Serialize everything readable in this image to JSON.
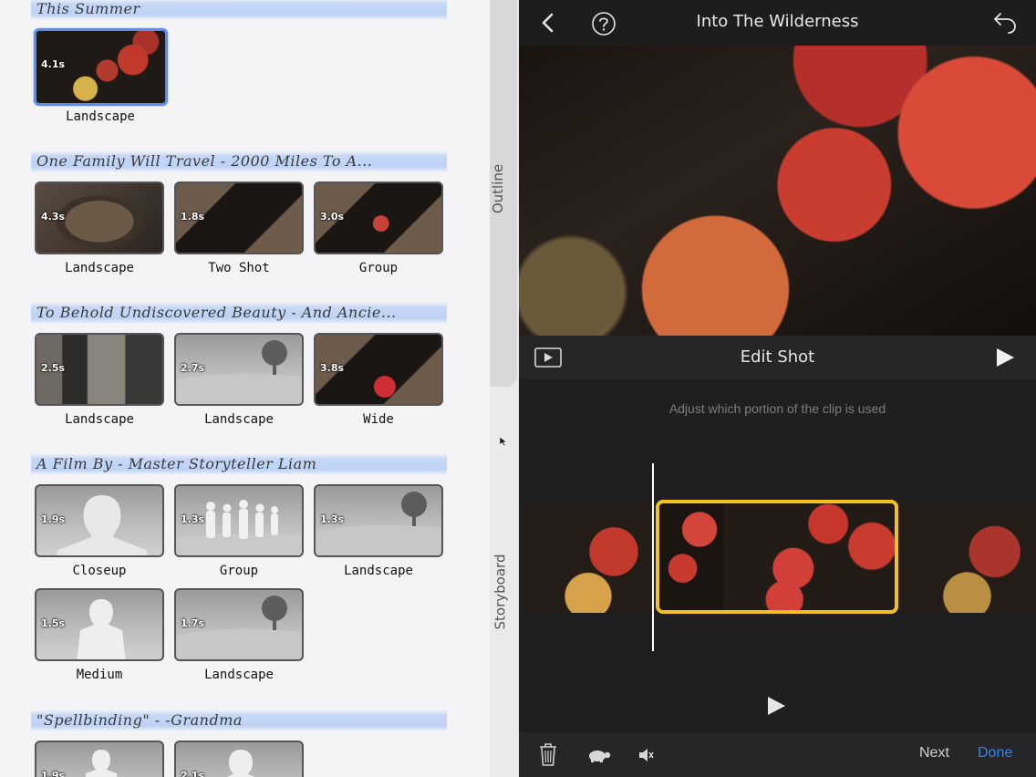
{
  "storyboard": {
    "sections": [
      {
        "title": "This Summer",
        "shots": [
          {
            "duration": "4.1s",
            "label": "Landscape",
            "type": "photo"
          }
        ]
      },
      {
        "title": "One Family Will Travel - 2000 Miles To A...",
        "shots": [
          {
            "duration": "4.3s",
            "label": "Landscape",
            "type": "photo"
          },
          {
            "duration": "1.8s",
            "label": "Two Shot",
            "type": "photo"
          },
          {
            "duration": "3.0s",
            "label": "Group",
            "type": "photo"
          }
        ]
      },
      {
        "title": "To Behold Undiscovered Beauty - And Ancie...",
        "shots": [
          {
            "duration": "2.5s",
            "label": "Landscape",
            "type": "photo"
          },
          {
            "duration": "2.7s",
            "label": "Landscape",
            "type": "placeholder-landscape"
          },
          {
            "duration": "3.8s",
            "label": "Wide",
            "type": "photo"
          }
        ]
      },
      {
        "title": "A Film By - Master Storyteller Liam",
        "shots": [
          {
            "duration": "1.9s",
            "label": "Closeup",
            "type": "placeholder-closeup"
          },
          {
            "duration": "1.3s",
            "label": "Group",
            "type": "placeholder-group"
          },
          {
            "duration": "1.3s",
            "label": "Landscape",
            "type": "placeholder-landscape"
          },
          {
            "duration": "1.5s",
            "label": "Medium",
            "type": "placeholder-medium"
          },
          {
            "duration": "1.7s",
            "label": "Landscape",
            "type": "placeholder-landscape"
          }
        ]
      },
      {
        "title": "\"Spellbinding\" - -Grandma",
        "shots": [
          {
            "duration": "1.9s",
            "label": "",
            "type": "placeholder-medium"
          },
          {
            "duration": "2.1s",
            "label": "",
            "type": "placeholder-medium"
          }
        ]
      }
    ],
    "side_tabs": {
      "outline": "Outline",
      "storyboard": "Storyboard"
    }
  },
  "editor": {
    "title": "Into The Wilderness",
    "edit_label": "Edit Shot",
    "hint": "Adjust which portion of the clip is used",
    "bottom": {
      "next": "Next",
      "done": "Done"
    },
    "accent_color": "#f3c21c",
    "done_color": "#2f86f0"
  }
}
